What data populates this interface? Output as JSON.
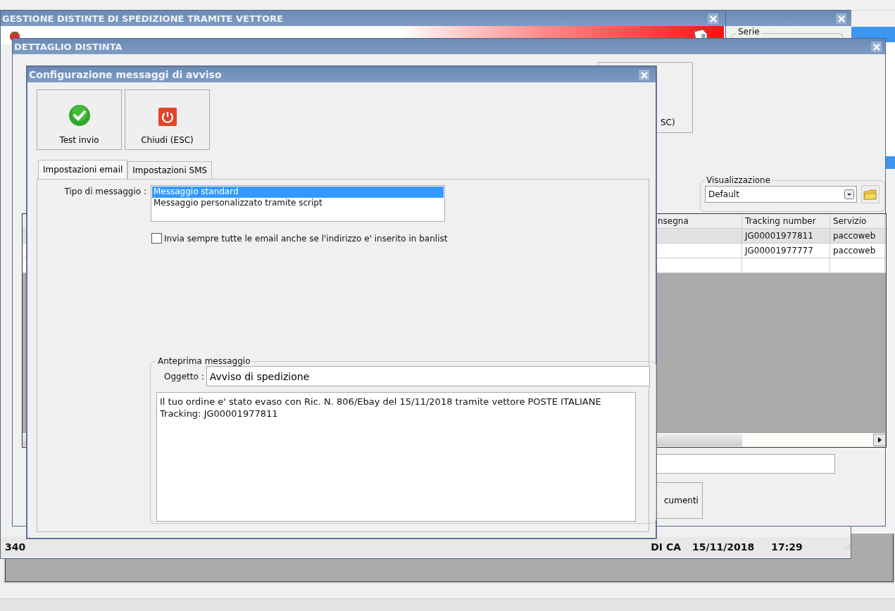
{
  "main_window": {
    "title": "GESTIONE DISTINTE DI SPEDIZIONE TRAMITE VETTORE",
    "status_bar": [
      "340",
      "DI CA",
      "15/11/2018",
      "17:29"
    ]
  },
  "side_window": {
    "group": "Serie"
  },
  "detail_window": {
    "title": "DETTAGLIO DISTINTA",
    "partial_button": "SC)",
    "view": {
      "label": "Visualizzazione",
      "value": "Default"
    },
    "table": {
      "columns": [
        "nsegna",
        "Tracking number",
        "Servizio"
      ],
      "rows": [
        {
          "tracking": "JG00001977811",
          "service": "paccoweb",
          "selected": true
        },
        {
          "tracking": "JG00001977777",
          "service": "paccoweb",
          "selected": false
        }
      ]
    },
    "documents_button": "cumenti"
  },
  "dialog": {
    "title": "Configurazione messaggi di avviso",
    "buttons": [
      {
        "label": "Test invio",
        "kind": "ok"
      },
      {
        "label": "Chiudi (ESC)",
        "kind": "close"
      }
    ],
    "tabs": [
      {
        "label": "Impostazioni email",
        "selected": true
      },
      {
        "label": "Impostazioni SMS",
        "selected": false
      }
    ],
    "message_type": {
      "label": "Tipo di messaggio :",
      "options": [
        {
          "label": "Messaggio standard",
          "selected": true
        },
        {
          "label": "Messaggio personalizzato tramite script",
          "selected": false
        }
      ]
    },
    "checkbox": {
      "label": "Invia sempre tutte le email anche se l'indirizzo e' inserito in banlist",
      "checked": false
    },
    "preview": {
      "title": "Anteprima messaggio",
      "subject_label": "Oggetto :",
      "subject": "Avviso di spedizione",
      "body": "Il tuo ordine e' stato evaso con Ric. N. 806/Ebay del 15/11/2018 tramite vettore POSTE ITALIANE\nTracking: JG00001977811"
    }
  }
}
